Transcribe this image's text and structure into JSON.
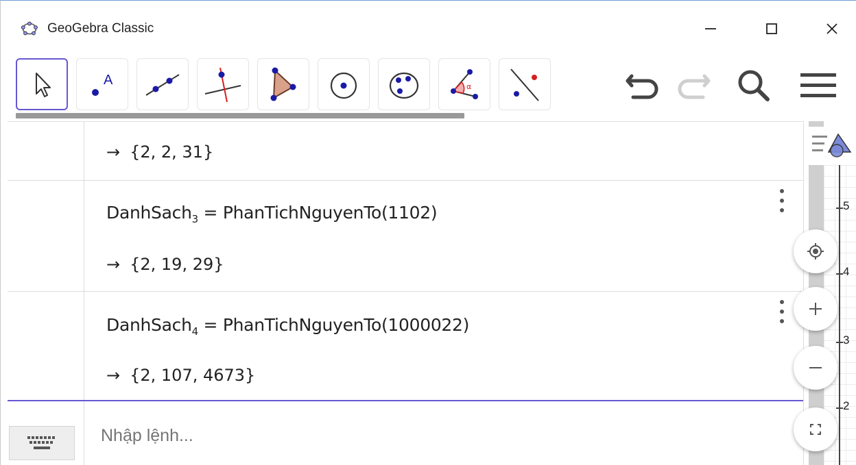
{
  "window": {
    "title": "GeoGebra Classic"
  },
  "toolbar": {
    "tools": [
      {
        "name": "move-tool",
        "icon": "cursor-arrow-icon"
      },
      {
        "name": "point-tool",
        "icon": "point-icon",
        "label": "A"
      },
      {
        "name": "line-tool",
        "icon": "line-icon"
      },
      {
        "name": "perpendicular-line-tool",
        "icon": "perpendicular-icon"
      },
      {
        "name": "polygon-tool",
        "icon": "polygon-icon"
      },
      {
        "name": "circle-tool",
        "icon": "circle-center-icon"
      },
      {
        "name": "circle-three-points-tool",
        "icon": "circle-three-points-icon"
      },
      {
        "name": "angle-tool",
        "icon": "angle-icon",
        "label": "α"
      },
      {
        "name": "reflect-tool",
        "icon": "reflect-icon"
      }
    ],
    "right": [
      "undo-icon",
      "redo-icon",
      "search-icon",
      "menu-icon"
    ]
  },
  "algebra": {
    "rows": [
      {
        "result": "{2, 2, 31}"
      },
      {
        "name": "DanhSach",
        "sub": "3",
        "command": "PhanTichNguyenTo",
        "arg": "(1102)",
        "result": "{2, 19, 29}"
      },
      {
        "name": "DanhSach",
        "sub": "4",
        "command": "PhanTichNguyenTo",
        "arg": "(1000022)",
        "result": "{2, 107, 4673}"
      }
    ],
    "arrow": "→",
    "equals": "=",
    "input_placeholder": "Nhập lệnh..."
  },
  "graphics": {
    "ticks": [
      "5",
      "4",
      "3",
      "2"
    ]
  },
  "colors": {
    "accent": "#6557d2",
    "polygon_fill": "#d9a08a",
    "point_blue": "#1a1aa6",
    "red": "#d62020"
  }
}
